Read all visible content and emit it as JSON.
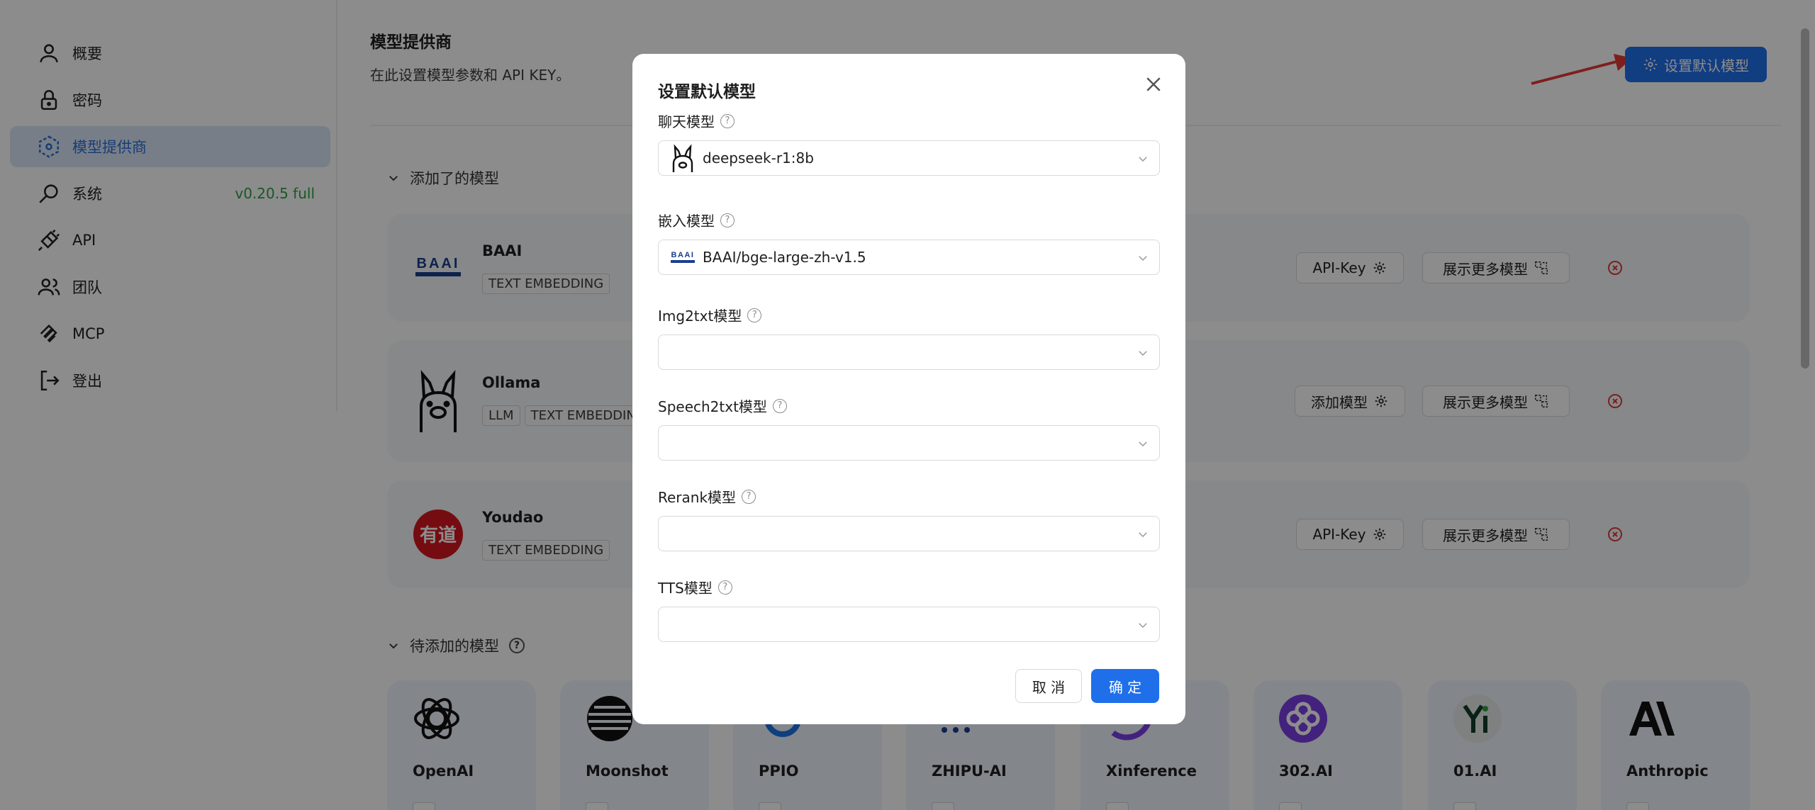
{
  "sidebar": {
    "items": [
      {
        "label": "概要",
        "icon": "user-icon"
      },
      {
        "label": "密码",
        "icon": "lock-icon"
      },
      {
        "label": "模型提供商",
        "icon": "cube-icon",
        "active": true
      },
      {
        "label": "系统",
        "icon": "search-icon",
        "version": "v0.20.5 full"
      },
      {
        "label": "API",
        "icon": "plug-icon"
      },
      {
        "label": "团队",
        "icon": "team-icon"
      },
      {
        "label": "MCP",
        "icon": "mcp-icon"
      },
      {
        "label": "登出",
        "icon": "logout-icon"
      }
    ]
  },
  "header": {
    "title": "模型提供商",
    "subtitle": "在此设置模型参数和 API KEY。",
    "default_button": "设置默认模型"
  },
  "added_section": {
    "title": "添加了的模型",
    "providers": [
      {
        "name": "BAAI",
        "tags": [
          "TEXT EMBEDDING"
        ],
        "key_button": "API-Key",
        "more_button": "展示更多模型"
      },
      {
        "name": "Ollama",
        "tags": [
          "LLM",
          "TEXT EMBEDDING"
        ],
        "key_button": "添加模型",
        "more_button": "展示更多模型"
      },
      {
        "name": "Youdao",
        "tags": [
          "TEXT EMBEDDING"
        ],
        "key_button": "API-Key",
        "more_button": "展示更多模型"
      }
    ]
  },
  "available_section": {
    "title": "待添加的模型",
    "providers": [
      "OpenAI",
      "Moonshot",
      "PPIO",
      "ZHIPU-AI",
      "Xinference",
      "302.AI",
      "01.AI",
      "Anthropic"
    ]
  },
  "modal": {
    "title": "设置默认模型",
    "fields": [
      {
        "label": "聊天模型",
        "value": "deepseek-r1:8b",
        "logo": "ollama"
      },
      {
        "label": "嵌入模型",
        "value": "BAAI/bge-large-zh-v1.5",
        "logo": "baai"
      },
      {
        "label": "Img2txt模型",
        "value": ""
      },
      {
        "label": "Speech2txt模型",
        "value": ""
      },
      {
        "label": "Rerank模型",
        "value": ""
      },
      {
        "label": "TTS模型",
        "value": ""
      }
    ],
    "cancel": "取 消",
    "ok": "确 定"
  },
  "logos": {
    "baai_text": "BAAI",
    "youdao_text": "有道"
  },
  "colors": {
    "primary": "#1f6feb",
    "active_nav_bg": "#d9e6f7",
    "version_green": "#2ea043",
    "delete_red": "#e03b3b",
    "arrow_red": "#e53935"
  }
}
